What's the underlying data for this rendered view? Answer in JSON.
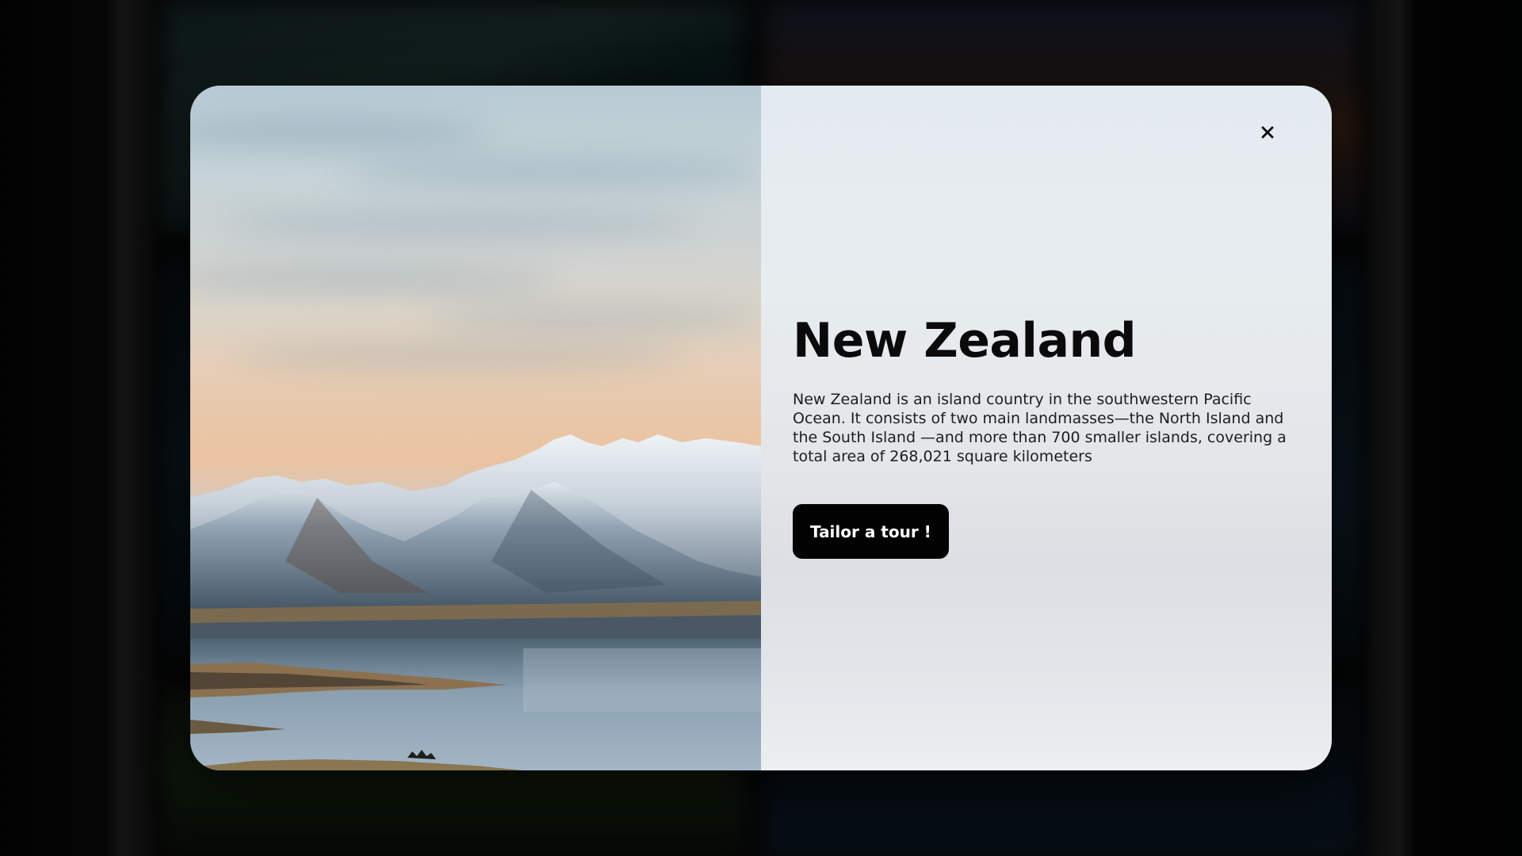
{
  "modal": {
    "title": "New Zealand",
    "description": "New Zealand is an island country in the southwestern Pacific Ocean. It consists of two main landmasses—the North Island and the South Island —and more than 700 smaller islands, covering a total area of 268,021 square kilometers",
    "cta_label": "Tailor a tour !",
    "close_icon": "close-icon",
    "image_subject": "snow-capped mountains over a lake",
    "colors": {
      "button_bg": "#020202",
      "button_text": "#ffffff",
      "panel_bg": "#e6ebef",
      "title": "#0a0a0a"
    }
  }
}
